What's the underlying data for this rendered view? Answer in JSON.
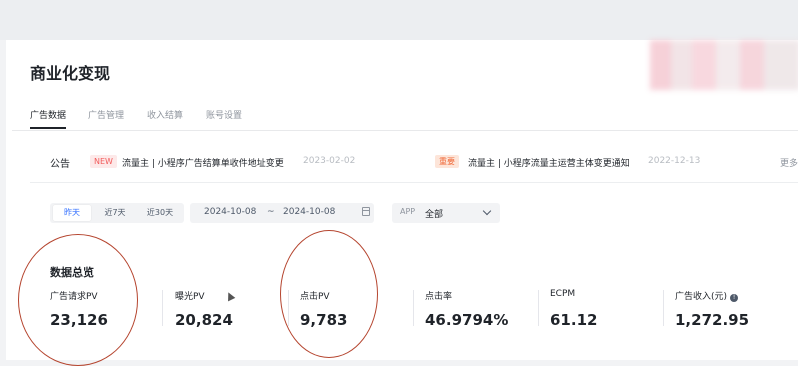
{
  "page": {
    "title": "商业化变现"
  },
  "tabs": [
    {
      "label": "广告数据",
      "active": true
    },
    {
      "label": "广告管理",
      "active": false
    },
    {
      "label": "收入结算",
      "active": false
    },
    {
      "label": "账号设置",
      "active": false
    }
  ],
  "notice": {
    "label": "公告",
    "items": [
      {
        "badge": "NEW",
        "text": "流量主 | 小程序广告结算单收件地址变更",
        "date": "2023-02-02"
      },
      {
        "badge": "重要",
        "text": "流量主 | 小程序流量主运营主体变更通知",
        "date": "2022-12-13"
      }
    ],
    "more": "更多"
  },
  "filters": {
    "ranges": [
      {
        "label": "昨天",
        "active": true
      },
      {
        "label": "近7天",
        "active": false
      },
      {
        "label": "近30天",
        "active": false
      }
    ],
    "date_start": "2024-10-08",
    "date_sep": "~",
    "date_end": "2024-10-08",
    "app_label": "APP",
    "app_value": "全部"
  },
  "overview": {
    "title": "数据总览",
    "stats": [
      {
        "label": "广告请求PV",
        "value": "23,126"
      },
      {
        "label": "曝光PV",
        "value": "20,824"
      },
      {
        "label": "点击PV",
        "value": "9,783"
      },
      {
        "label": "点击率",
        "value": "46.9794%"
      },
      {
        "label": "ECPM",
        "value": "61.12"
      },
      {
        "label": "广告收入(元)",
        "value": "1,272.95",
        "info_icon": "info-icon"
      }
    ]
  },
  "colors": {
    "accent": "#3370ff",
    "annotation": "#b5452f",
    "badge_new": "#f25c5c",
    "badge_important": "#f06a3a"
  }
}
